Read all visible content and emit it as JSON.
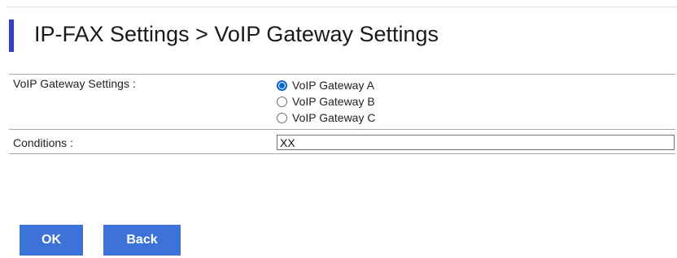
{
  "page": {
    "title": "IP-FAX Settings > VoIP Gateway Settings"
  },
  "form": {
    "gateway": {
      "label": "VoIP Gateway Settings :",
      "options": [
        {
          "label": "VoIP Gateway A",
          "checked": true
        },
        {
          "label": "VoIP Gateway B",
          "checked": false
        },
        {
          "label": "VoIP Gateway C",
          "checked": false
        }
      ]
    },
    "conditions": {
      "label": "Conditions :",
      "value": "XX"
    }
  },
  "buttons": {
    "ok": "OK",
    "back": "Back"
  },
  "colors": {
    "accent": "#2f3fc8",
    "button": "#3d72d9",
    "radio_selected": "#0a64d6"
  },
  "icons": {
    "title_marker": "title-accent-bar",
    "radio": "radio-icon"
  }
}
